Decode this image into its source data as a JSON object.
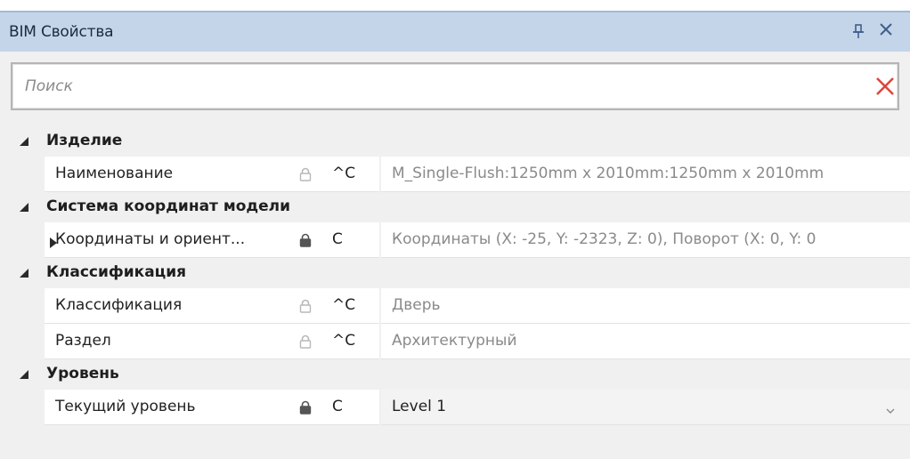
{
  "panel": {
    "title": "BIM Свойства",
    "icons": {
      "pin": "pin-icon",
      "close": "close-icon"
    }
  },
  "search": {
    "placeholder": "Поиск",
    "value": "",
    "clear_icon": "clear-x-icon",
    "clear_color": "#e0453a"
  },
  "categories": [
    {
      "label": "Изделие",
      "properties": [
        {
          "name": "Наименование",
          "locked": false,
          "scope": "^C",
          "value": "M_Single-Flush:1250mm x 2010mm:1250mm x 2010mm",
          "expandable": false,
          "editable": false
        }
      ]
    },
    {
      "label": "Система координат модели",
      "properties": [
        {
          "name": "Координаты и ориент...",
          "locked": true,
          "scope": "C",
          "value": "Координаты (X: -25, Y: -2323, Z: 0), Поворот (X: 0, Y: 0",
          "expandable": true,
          "editable": false
        }
      ]
    },
    {
      "label": "Классификация",
      "properties": [
        {
          "name": "Классификация",
          "locked": false,
          "scope": "^C",
          "value": "Дверь",
          "expandable": false,
          "editable": false
        },
        {
          "name": "Раздел",
          "locked": false,
          "scope": "^C",
          "value": "Архитектурный",
          "expandable": false,
          "editable": false
        }
      ]
    },
    {
      "label": "Уровень",
      "properties": [
        {
          "name": "Текущий уровень",
          "locked": true,
          "scope": "C",
          "value": "Level 1",
          "expandable": false,
          "editable": true,
          "dropdown": true
        }
      ]
    }
  ],
  "colors": {
    "title_bar": "#c4d5ea",
    "lock_closed": "#555555",
    "lock_open": "#b8b8b8"
  }
}
